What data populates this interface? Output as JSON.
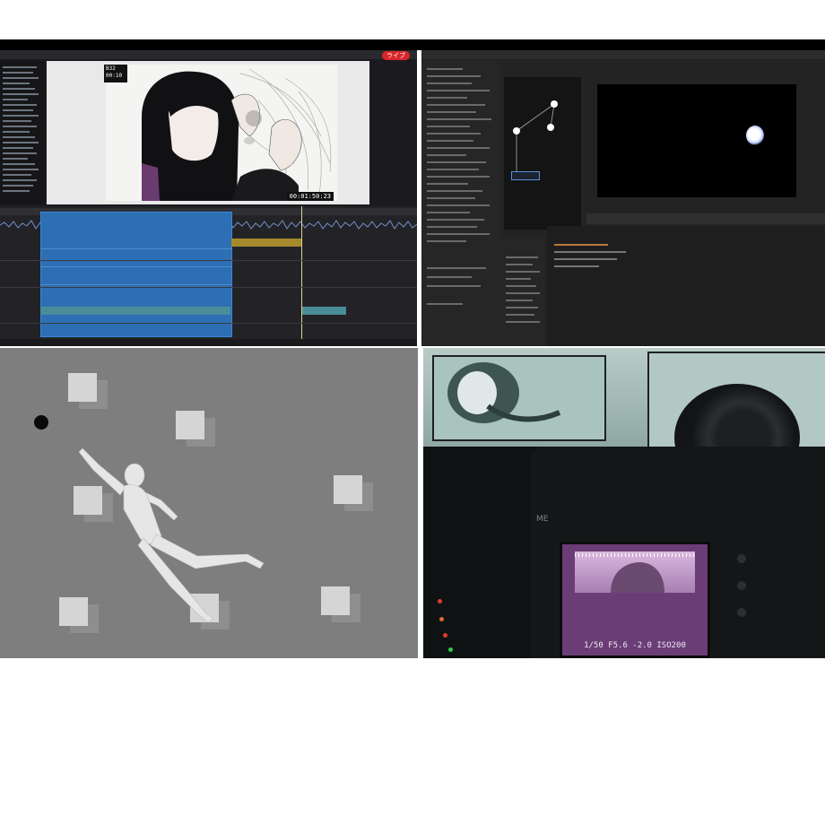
{
  "editor": {
    "live_badge": "ライブ",
    "overlay_line1": "B32",
    "overlay_line2": "00:10",
    "timecode": "00:01:50:23"
  },
  "compositor": {
    "panel_title": "Particle Setup"
  },
  "camera": {
    "brand_label": "ME",
    "readout": "1/50  F5.6  -2.0  ISO200"
  },
  "colors": {
    "timeline_clip": "#2d6fb4",
    "live_badge": "#d9262a",
    "camera_screen": "#6b3d77"
  }
}
